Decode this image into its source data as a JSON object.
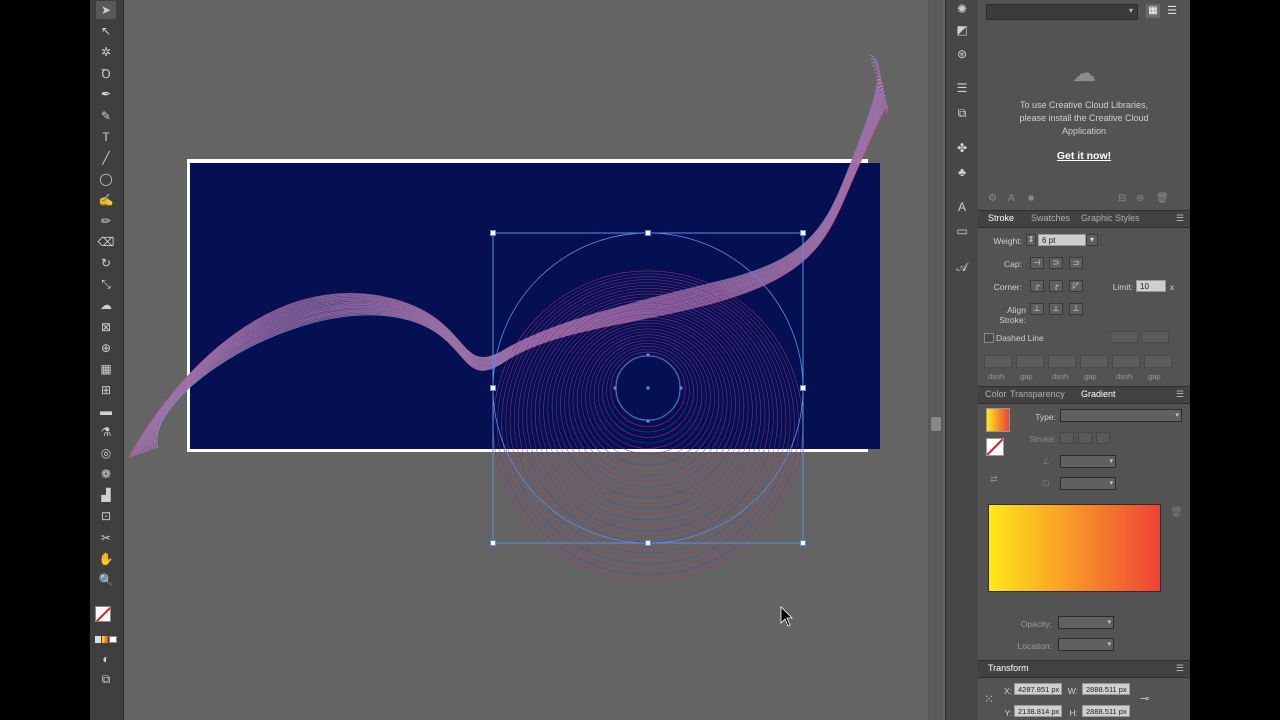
{
  "tools": [
    {
      "name": "selection-tool-icon",
      "glyph": "➤"
    },
    {
      "name": "direct-selection-tool-icon",
      "glyph": "↖"
    },
    {
      "name": "magic-wand-tool-icon",
      "glyph": "✲"
    },
    {
      "name": "lasso-tool-icon",
      "glyph": "Ꝺ"
    },
    {
      "name": "pen-tool-icon",
      "glyph": "✒"
    },
    {
      "name": "curvature-tool-icon",
      "glyph": "✎"
    },
    {
      "name": "type-tool-icon",
      "glyph": "T"
    },
    {
      "name": "line-tool-icon",
      "glyph": "╱"
    },
    {
      "name": "ellipse-tool-icon",
      "glyph": "◯"
    },
    {
      "name": "paintbrush-tool-icon",
      "glyph": "✍"
    },
    {
      "name": "pencil-tool-icon",
      "glyph": "✏"
    },
    {
      "name": "eraser-tool-icon",
      "glyph": "⌫"
    },
    {
      "name": "rotate-tool-icon",
      "glyph": "↻"
    },
    {
      "name": "scale-tool-icon",
      "glyph": "⤡"
    },
    {
      "name": "warp-tool-icon",
      "glyph": "☁"
    },
    {
      "name": "free-transform-tool-icon",
      "glyph": "⊠"
    },
    {
      "name": "shape-builder-tool-icon",
      "glyph": "⊕"
    },
    {
      "name": "perspective-grid-tool-icon",
      "glyph": "▦"
    },
    {
      "name": "mesh-tool-icon",
      "glyph": "⊞"
    },
    {
      "name": "gradient-tool-icon",
      "glyph": "▬"
    },
    {
      "name": "eyedropper-tool-icon",
      "glyph": "⚗"
    },
    {
      "name": "blend-tool-icon",
      "glyph": "◎"
    },
    {
      "name": "symbol-sprayer-tool-icon",
      "glyph": "❁"
    },
    {
      "name": "column-graph-tool-icon",
      "glyph": "▟"
    },
    {
      "name": "artboard-tool-icon",
      "glyph": "⊡"
    },
    {
      "name": "slice-tool-icon",
      "glyph": "✂"
    },
    {
      "name": "hand-tool-icon",
      "glyph": "✋"
    },
    {
      "name": "zoom-tool-icon",
      "glyph": "🔍"
    }
  ],
  "dock_icons": [
    {
      "name": "color-guide-icon",
      "glyph": "✺"
    },
    {
      "name": "gradient-panel-icon",
      "glyph": "◩"
    },
    {
      "name": "appearance-icon",
      "glyph": "⊛"
    },
    {
      "name": "align-icon",
      "glyph": "☰"
    },
    {
      "name": "pathfinder-icon",
      "glyph": "⧉"
    },
    {
      "name": "brushes-icon",
      "glyph": "✤"
    },
    {
      "name": "symbols-icon",
      "glyph": "♣"
    },
    {
      "name": "type-icon",
      "glyph": "A"
    },
    {
      "name": "stroke-icon",
      "glyph": "▭"
    },
    {
      "name": "character-icon",
      "glyph": "𝒜"
    }
  ],
  "libraries": {
    "message": "To use Creative Cloud Libraries, please install the Creative Cloud Application",
    "link": "Get it now!"
  },
  "stroke_panel": {
    "tabs": [
      "Stroke",
      "Swatches",
      "Graphic Styles"
    ],
    "weight_label": "Weight:",
    "weight_value": "6 pt",
    "cap_label": "Cap:",
    "corner_label": "Corner:",
    "limit_label": "Limit:",
    "limit_value": "10",
    "limit_unit": "x",
    "align_label": "Align Stroke:",
    "dashed_label": "Dashed Line",
    "dash_labels": [
      "dash",
      "gap",
      "dash",
      "gap",
      "dash",
      "gap"
    ]
  },
  "gradient_panel": {
    "tabs": [
      "Color",
      "Transparency",
      "Gradient"
    ],
    "type_label": "Type:",
    "stroke_label": "Stroke:",
    "opacity_label": "Opacity:",
    "location_label": "Location:",
    "start_color": "#ffe81a",
    "end_color": "#ee4236"
  },
  "transform_panel": {
    "title": "Transform",
    "x_label": "X:",
    "x_value": "4287.851 px",
    "y_label": "Y:",
    "y_value": "2138.814 px",
    "w_label": "W:",
    "w_value": "2888.511 px",
    "h_label": "H:",
    "h_value": "2888.511 px"
  },
  "colors": {
    "artboard": "#051052",
    "wave_start": "#3cc6ff",
    "wave_end": "#ff1a4f",
    "selection": "#5b8fe0"
  }
}
